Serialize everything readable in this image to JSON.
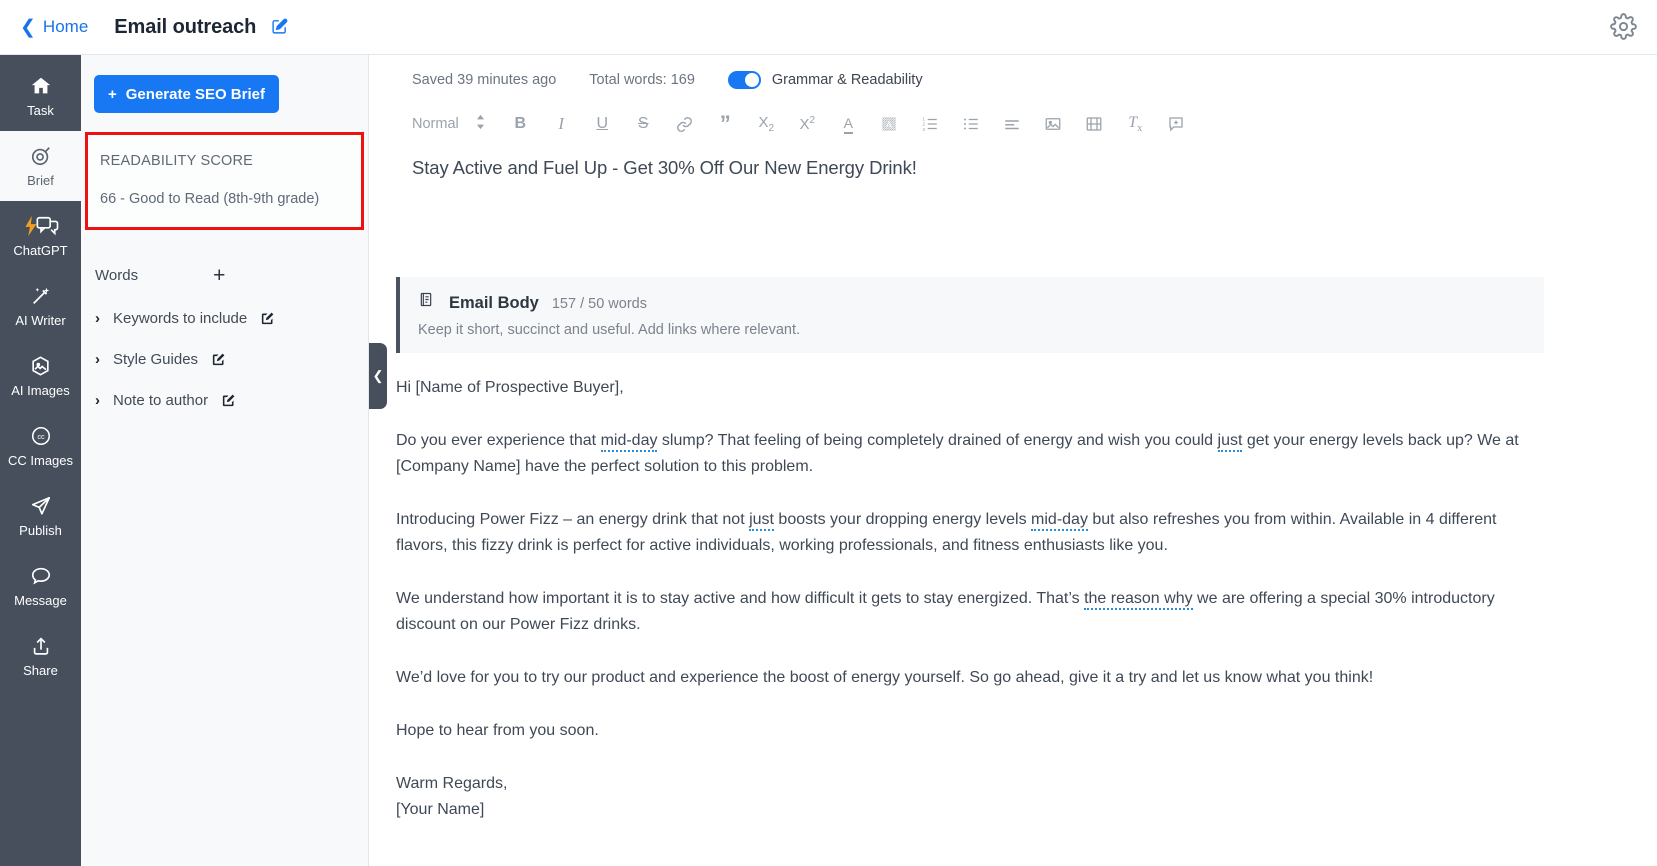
{
  "topbar": {
    "home_label": "Home",
    "back_icon": "chevron-left-icon",
    "doc_title": "Email outreach",
    "title_edit_icon": "edit-pencil-icon",
    "settings_icon": "gear-icon"
  },
  "rail": {
    "items": [
      {
        "label": "Task",
        "icon": "home-icon",
        "active": false
      },
      {
        "label": "Brief",
        "icon": "target-brief-icon",
        "active": true
      },
      {
        "label": "ChatGPT",
        "icon": "chat-bolt-icon",
        "active": false
      },
      {
        "label": "AI Writer",
        "icon": "magic-wand-icon",
        "active": false
      },
      {
        "label": "AI Images",
        "icon": "image-hexagon-icon",
        "active": false
      },
      {
        "label": "CC Images",
        "icon": "creative-commons-icon",
        "active": false
      },
      {
        "label": "Publish",
        "icon": "paper-plane-icon",
        "active": false
      },
      {
        "label": "Message",
        "icon": "speech-bubble-icon",
        "active": false
      },
      {
        "label": "Share",
        "icon": "share-upload-icon",
        "active": false
      }
    ]
  },
  "panel": {
    "generate_button": "Generate SEO Brief",
    "generate_icon": "plus-icon",
    "readability": {
      "label": "READABILITY SCORE",
      "value": "66 - Good to Read (8th-9th grade)",
      "highlight_color": "#ee1111"
    },
    "words_label": "Words",
    "words_add_icon": "plus-icon",
    "accordions": [
      {
        "label": "Keywords to include",
        "chevron": "chevron-right-icon",
        "edit_icon": "edit-pencil-icon"
      },
      {
        "label": "Style Guides",
        "chevron": "chevron-right-icon",
        "edit_icon": "edit-pencil-icon"
      },
      {
        "label": "Note to author",
        "chevron": "chevron-right-icon",
        "edit_icon": "edit-pencil-icon"
      }
    ],
    "collapse_handle_icon": "chevron-left-icon"
  },
  "editor": {
    "saved_status": "Saved 39 minutes ago",
    "total_words": "Total words: 169",
    "grammar_toggle_label": "Grammar & Readability",
    "grammar_toggle_on": true,
    "toggle_color": "#1877f2",
    "toolbar": {
      "style_select": "Normal",
      "style_caret_icon": "chevron-updown-icon",
      "buttons": [
        {
          "name": "bold-button",
          "glyph": "B"
        },
        {
          "name": "italic-button",
          "glyph": "I"
        },
        {
          "name": "underline-button",
          "glyph": "U"
        },
        {
          "name": "strikethrough-button",
          "glyph": "S"
        },
        {
          "name": "link-button",
          "glyph": "link-icon"
        },
        {
          "name": "blockquote-button",
          "glyph": "quote-icon"
        },
        {
          "name": "subscript-button",
          "glyph": "x-sub-icon"
        },
        {
          "name": "superscript-button",
          "glyph": "x-sup-icon"
        },
        {
          "name": "text-color-button",
          "glyph": "font-color-icon"
        },
        {
          "name": "highlight-color-button",
          "glyph": "highlight-icon"
        },
        {
          "name": "ordered-list-button",
          "glyph": "numbered-list-icon"
        },
        {
          "name": "bullet-list-button",
          "glyph": "bullet-list-icon"
        },
        {
          "name": "align-button",
          "glyph": "align-left-icon"
        },
        {
          "name": "insert-image-button",
          "glyph": "image-icon"
        },
        {
          "name": "insert-video-button",
          "glyph": "film-icon"
        },
        {
          "name": "clear-format-button",
          "glyph": "clear-formatting-icon"
        },
        {
          "name": "add-comment-button",
          "glyph": "comment-plus-icon"
        }
      ]
    },
    "doc_heading": "Stay Active and Fuel Up - Get 30% Off Our New Energy Drink!",
    "section": {
      "icon": "document-section-icon",
      "title": "Email Body",
      "count": "157 / 50 words",
      "subtitle": "Keep it short, succinct and useful. Add links where relevant."
    },
    "paragraphs": [
      {
        "id": "p-greeting",
        "segments": [
          {
            "t": "Hi [Name of Prospective Buyer],"
          }
        ]
      },
      {
        "id": "p-hook",
        "segments": [
          {
            "t": "Do you ever experience that "
          },
          {
            "t": "mid-day",
            "suggestion": true
          },
          {
            "t": " slump? That feeling of being completely drained of energy and wish you could "
          },
          {
            "t": "just",
            "suggestion": true
          },
          {
            "t": " get your energy levels back up? We at [Company Name] have the perfect solution to this problem."
          }
        ]
      },
      {
        "id": "p-intro",
        "segments": [
          {
            "t": "Introducing Power Fizz – an energy drink that not "
          },
          {
            "t": "just",
            "suggestion": true
          },
          {
            "t": " boosts your dropping energy levels "
          },
          {
            "t": "mid-day",
            "suggestion": true
          },
          {
            "t": " but also refreshes you from within. Available in 4 different flavors, this fizzy drink is perfect for active individuals, working professionals, and fitness enthusiasts like you."
          }
        ]
      },
      {
        "id": "p-offer",
        "segments": [
          {
            "t": "We understand how important it is to stay active and how difficult it gets to stay energized. That’s "
          },
          {
            "t": "the reason why",
            "suggestion": true
          },
          {
            "t": " we are offering a special 30% introductory discount on our Power Fizz drinks."
          }
        ]
      },
      {
        "id": "p-cta",
        "segments": [
          {
            "t": "We’d love for you to try our product and experience the boost of energy yourself. So go ahead, give it a try and let us know what you think!"
          }
        ]
      },
      {
        "id": "p-close",
        "segments": [
          {
            "t": "Hope to hear from you soon."
          }
        ]
      },
      {
        "id": "p-signoff",
        "segments": [
          {
            "t": "Warm Regards,"
          }
        ],
        "tight": true
      },
      {
        "id": "p-name",
        "segments": [
          {
            "t": "[Your Name]"
          }
        ]
      }
    ],
    "suggestion_underline_color": "#2b8ad6"
  }
}
